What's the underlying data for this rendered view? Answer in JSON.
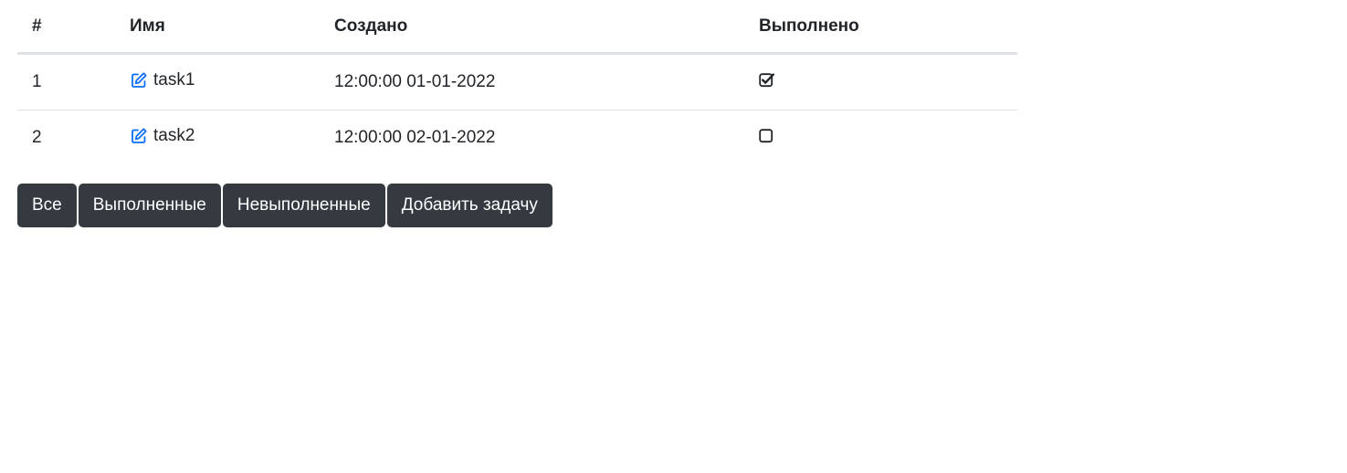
{
  "table": {
    "headers": {
      "num": "#",
      "name": "Имя",
      "created": "Создано",
      "done": "Выполнено"
    },
    "rows": [
      {
        "num": "1",
        "name": "task1",
        "created": "12:00:00 01-01-2022",
        "done": true
      },
      {
        "num": "2",
        "name": "task2",
        "created": "12:00:00 02-01-2022",
        "done": false
      }
    ]
  },
  "buttons": {
    "all": "Все",
    "completed": "Выполненные",
    "uncompleted": "Невыполненные",
    "add": "Добавить задачу"
  },
  "colors": {
    "edit_icon": "#0d6efd",
    "button_bg": "#343a40"
  },
  "icons": {
    "edit": "edit-icon",
    "checked": "checkbox-checked-icon",
    "unchecked": "checkbox-unchecked-icon"
  }
}
